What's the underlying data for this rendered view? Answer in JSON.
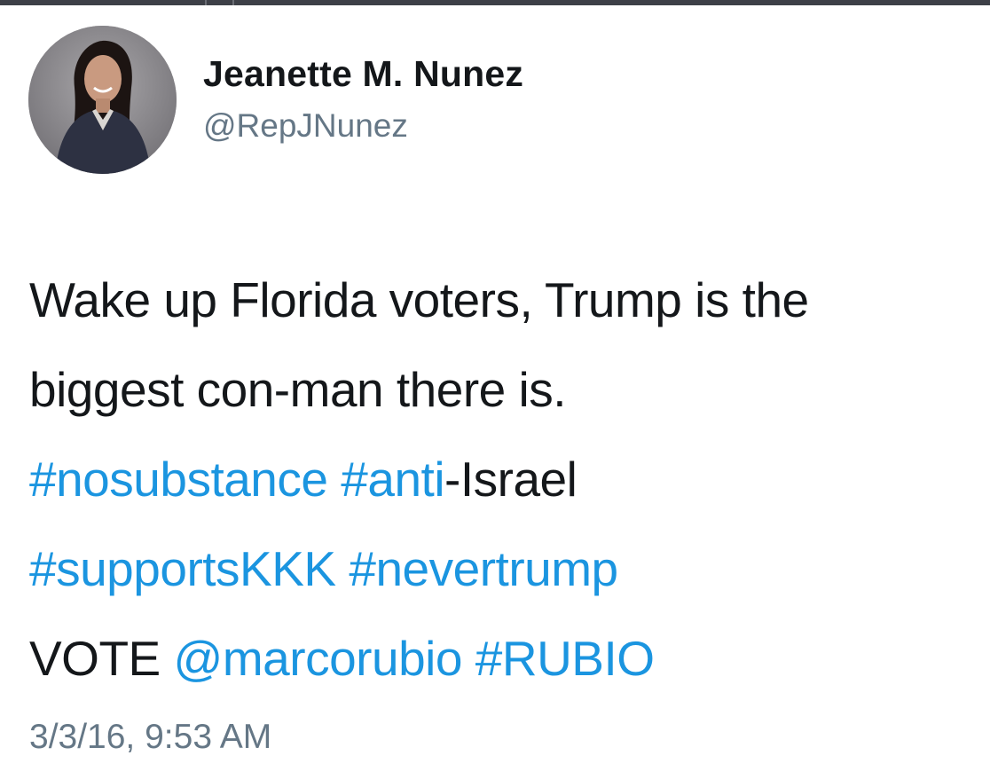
{
  "tweet": {
    "display_name": "Jeanette M. Nunez",
    "handle": "@RepJNunez",
    "text": {
      "line1": "Wake up Florida voters, Trump is the",
      "line2": "biggest con-man there is.",
      "hashtag_nosubstance": "#nosubstance",
      "hashtag_anti": "#anti",
      "israel_text": "-Israel",
      "hashtag_supportskkk": "#supportsKKK",
      "hashtag_nevertrump": "#nevertrump",
      "vote_text": "VOTE",
      "mention_marcorubio": "@marcorubio",
      "hashtag_rubio": "#RUBIO"
    },
    "timestamp": "3/3/16, 9:53 AM"
  },
  "colors": {
    "text": "#14171a",
    "secondary": "#657786",
    "link": "#1b95e0",
    "background": "#ffffff"
  },
  "icons": {
    "avatar": "profile-photo"
  }
}
